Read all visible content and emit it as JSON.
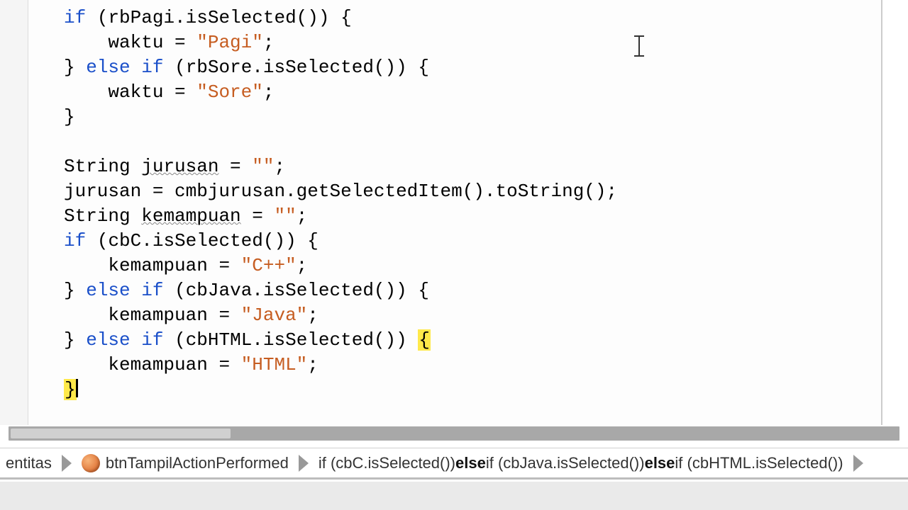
{
  "code": {
    "if": "if",
    "else": "else",
    "string_t": "String",
    "rbPagi": "rbPagi.isSelected()",
    "waktu_pagi": "waktu = ",
    "pagi_str": "\"Pagi\"",
    "rbSore": "rbSore.isSelected()",
    "waktu_sore": "waktu = ",
    "sore_str": "\"Sore\"",
    "jurusan_decl": " jurusan = ",
    "empty1": "\"\"",
    "jurusan_assign": "jurusan = cmbjurusan.getSelectedItem().toString();",
    "kemampuan_decl": " kemampuan = ",
    "empty2": "\"\"",
    "cbC": "cbC.isSelected()",
    "k_cpp": "kemampuan = ",
    "cpp_str": "\"C++\"",
    "cbJava": "cbJava.isSelected()",
    "k_java": "kemampuan = ",
    "java_str": "\"Java\"",
    "cbHTML": "cbHTML.isSelected()",
    "k_html": "kemampuan = ",
    "html_str": "\"HTML\"",
    "open_brace": "{",
    "close_brace": "}",
    "semi": ";",
    "paren_o": "(",
    "paren_c": ")",
    "sp": " ",
    "jurusan_word": "jurusan",
    "kemampuan_word": "kemampuan"
  },
  "breadcrumb": {
    "item0": "entitas",
    "item1": "btnTampilActionPerformed",
    "item2_pre": "if (cbC.isSelected()) ",
    "item2_else1": "else",
    "item2_mid1": " if (cbJava.isSelected()) ",
    "item2_else2": "else",
    "item2_mid2": " if (cbHTML.isSelected())"
  }
}
